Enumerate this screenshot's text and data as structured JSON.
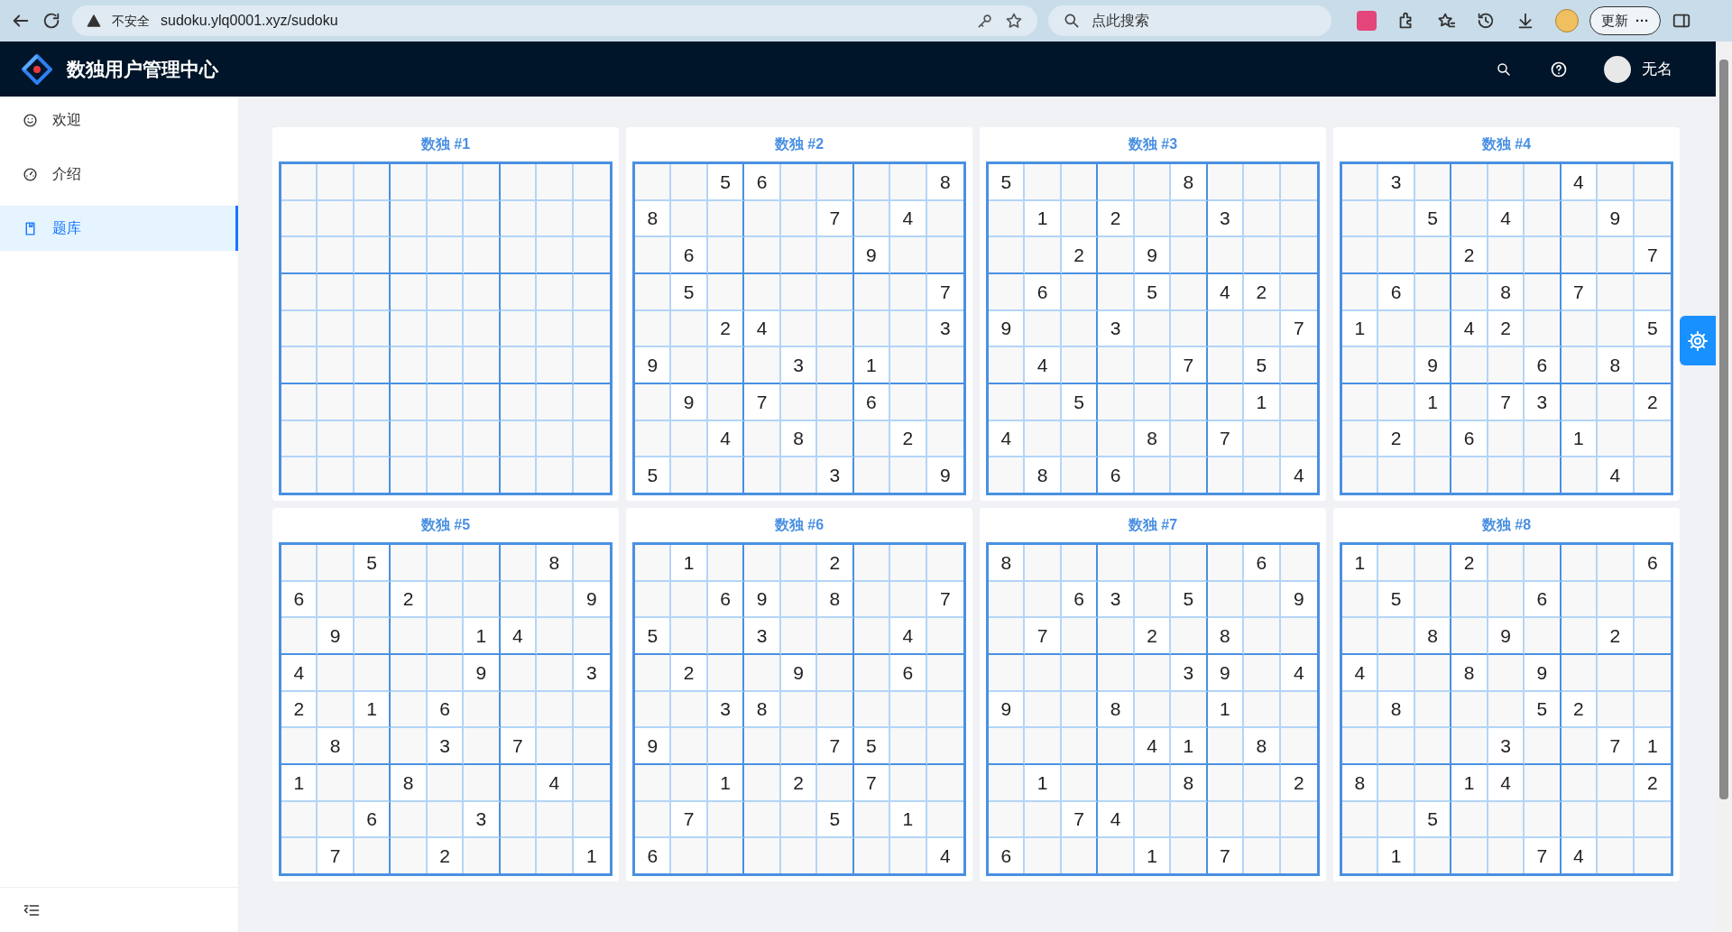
{
  "browser": {
    "security_label": "不安全",
    "url": "sudoku.ylq0001.xyz/sudoku",
    "search_placeholder": "点此搜索",
    "update_button": "更新",
    "more_button": "···"
  },
  "header": {
    "title": "数独用户管理中心",
    "user_name": "无名"
  },
  "sidebar": {
    "items": [
      {
        "label": "欢迎",
        "selected": false
      },
      {
        "label": "介绍",
        "selected": false
      },
      {
        "label": "题库",
        "selected": true
      }
    ]
  },
  "puzzles": [
    {
      "title": "数独 #1",
      "rows": [
        [
          null,
          null,
          null,
          null,
          null,
          null,
          null,
          null,
          null
        ],
        [
          null,
          null,
          null,
          null,
          null,
          null,
          null,
          null,
          null
        ],
        [
          null,
          null,
          null,
          null,
          null,
          null,
          null,
          null,
          null
        ],
        [
          null,
          null,
          null,
          null,
          null,
          null,
          null,
          null,
          null
        ],
        [
          null,
          null,
          null,
          null,
          null,
          null,
          null,
          null,
          null
        ],
        [
          null,
          null,
          null,
          null,
          null,
          null,
          null,
          null,
          null
        ],
        [
          null,
          null,
          null,
          null,
          null,
          null,
          null,
          null,
          null
        ],
        [
          null,
          null,
          null,
          null,
          null,
          null,
          null,
          null,
          null
        ],
        [
          null,
          null,
          null,
          null,
          null,
          null,
          null,
          null,
          null
        ]
      ]
    },
    {
      "title": "数独 #2",
      "rows": [
        [
          null,
          null,
          "5",
          "6",
          null,
          null,
          null,
          null,
          "8"
        ],
        [
          "8",
          null,
          null,
          null,
          null,
          "7",
          null,
          "4",
          null
        ],
        [
          null,
          "6",
          null,
          null,
          null,
          null,
          "9",
          null,
          null
        ],
        [
          null,
          "5",
          null,
          null,
          null,
          null,
          null,
          null,
          "7"
        ],
        [
          null,
          null,
          "2",
          "4",
          null,
          null,
          null,
          null,
          "3"
        ],
        [
          "9",
          null,
          null,
          null,
          "3",
          null,
          "1",
          null,
          null
        ],
        [
          null,
          "9",
          null,
          "7",
          null,
          null,
          "6",
          null,
          null
        ],
        [
          null,
          null,
          "4",
          null,
          "8",
          null,
          null,
          "2",
          null
        ],
        [
          "5",
          null,
          null,
          null,
          null,
          "3",
          null,
          null,
          "9"
        ]
      ]
    },
    {
      "title": "数独 #3",
      "rows": [
        [
          "5",
          null,
          null,
          null,
          null,
          "8",
          null,
          null,
          null
        ],
        [
          null,
          "1",
          null,
          "2",
          null,
          null,
          "3",
          null,
          null
        ],
        [
          null,
          null,
          "2",
          null,
          "9",
          null,
          null,
          null,
          null
        ],
        [
          null,
          "6",
          null,
          null,
          "5",
          null,
          "4",
          "2",
          null
        ],
        [
          "9",
          null,
          null,
          "3",
          null,
          null,
          null,
          null,
          "7"
        ],
        [
          null,
          "4",
          null,
          null,
          null,
          "7",
          null,
          "5",
          null
        ],
        [
          null,
          null,
          "5",
          null,
          null,
          null,
          null,
          "1",
          null
        ],
        [
          "4",
          null,
          null,
          null,
          "8",
          null,
          "7",
          null,
          null
        ],
        [
          null,
          "8",
          null,
          "6",
          null,
          null,
          null,
          null,
          "4"
        ]
      ]
    },
    {
      "title": "数独 #4",
      "rows": [
        [
          null,
          "3",
          null,
          null,
          null,
          null,
          "4",
          null,
          null
        ],
        [
          null,
          null,
          "5",
          null,
          "4",
          null,
          null,
          "9",
          null
        ],
        [
          null,
          null,
          null,
          "2",
          null,
          null,
          null,
          null,
          "7"
        ],
        [
          null,
          "6",
          null,
          null,
          "8",
          null,
          "7",
          null,
          null
        ],
        [
          "1",
          null,
          null,
          "4",
          "2",
          null,
          null,
          null,
          "5"
        ],
        [
          null,
          null,
          "9",
          null,
          null,
          "6",
          null,
          "8",
          null
        ],
        [
          null,
          null,
          "1",
          null,
          "7",
          "3",
          null,
          null,
          "2"
        ],
        [
          null,
          "2",
          null,
          "6",
          null,
          null,
          "1",
          null,
          null
        ],
        [
          null,
          null,
          null,
          null,
          null,
          null,
          null,
          "4",
          null
        ]
      ]
    },
    {
      "title": "数独 #5",
      "rows": [
        [
          null,
          null,
          "5",
          null,
          null,
          null,
          null,
          "8",
          null
        ],
        [
          "6",
          null,
          null,
          "2",
          null,
          null,
          null,
          null,
          "9"
        ],
        [
          null,
          "9",
          null,
          null,
          null,
          "1",
          "4",
          null,
          null
        ],
        [
          "4",
          null,
          null,
          null,
          null,
          "9",
          null,
          null,
          "3"
        ],
        [
          "2",
          null,
          "1",
          null,
          "6",
          null,
          null,
          null,
          null
        ],
        [
          null,
          "8",
          null,
          null,
          "3",
          null,
          "7",
          null,
          null
        ],
        [
          "1",
          null,
          null,
          "8",
          null,
          null,
          null,
          "4",
          null
        ],
        [
          null,
          null,
          "6",
          null,
          null,
          "3",
          null,
          null,
          null
        ],
        [
          null,
          "7",
          null,
          null,
          "2",
          null,
          null,
          null,
          "1"
        ]
      ]
    },
    {
      "title": "数独 #6",
      "rows": [
        [
          null,
          "1",
          null,
          null,
          null,
          "2",
          null,
          null,
          null
        ],
        [
          null,
          null,
          "6",
          "9",
          null,
          "8",
          null,
          null,
          "7"
        ],
        [
          "5",
          null,
          null,
          "3",
          null,
          null,
          null,
          "4",
          null
        ],
        [
          null,
          "2",
          null,
          null,
          "9",
          null,
          null,
          "6",
          null
        ],
        [
          null,
          null,
          "3",
          "8",
          null,
          null,
          null,
          null,
          null
        ],
        [
          "9",
          null,
          null,
          null,
          null,
          "7",
          "5",
          null,
          null
        ],
        [
          null,
          null,
          "1",
          null,
          "2",
          null,
          "7",
          null,
          null
        ],
        [
          null,
          "7",
          null,
          null,
          null,
          "5",
          null,
          "1",
          null
        ],
        [
          "6",
          null,
          null,
          null,
          null,
          null,
          null,
          null,
          "4"
        ]
      ]
    },
    {
      "title": "数独 #7",
      "rows": [
        [
          "8",
          null,
          null,
          null,
          null,
          null,
          null,
          "6",
          null
        ],
        [
          null,
          null,
          "6",
          "3",
          null,
          "5",
          null,
          null,
          "9"
        ],
        [
          null,
          "7",
          null,
          null,
          "2",
          null,
          "8",
          null,
          null
        ],
        [
          null,
          null,
          null,
          null,
          null,
          "3",
          "9",
          null,
          "4"
        ],
        [
          "9",
          null,
          null,
          "8",
          null,
          null,
          "1",
          null,
          null
        ],
        [
          null,
          null,
          null,
          null,
          "4",
          "1",
          null,
          "8",
          null
        ],
        [
          null,
          "1",
          null,
          null,
          null,
          "8",
          null,
          null,
          "2"
        ],
        [
          null,
          null,
          "7",
          "4",
          null,
          null,
          null,
          null,
          null
        ],
        [
          "6",
          null,
          null,
          null,
          "1",
          null,
          "7",
          null,
          null
        ]
      ]
    },
    {
      "title": "数独 #8",
      "rows": [
        [
          "1",
          null,
          null,
          "2",
          null,
          null,
          null,
          null,
          "6"
        ],
        [
          null,
          "5",
          null,
          null,
          null,
          "6",
          null,
          null,
          null
        ],
        [
          null,
          null,
          "8",
          null,
          "9",
          null,
          null,
          "2",
          null
        ],
        [
          "4",
          null,
          null,
          "8",
          null,
          "9",
          null,
          null,
          null
        ],
        [
          null,
          "8",
          null,
          null,
          null,
          "5",
          "2",
          null,
          null
        ],
        [
          null,
          null,
          null,
          null,
          "3",
          null,
          null,
          "7",
          "1"
        ],
        [
          "8",
          null,
          null,
          "1",
          "4",
          null,
          null,
          null,
          "2"
        ],
        [
          null,
          null,
          "5",
          null,
          null,
          null,
          null,
          null,
          null
        ],
        [
          null,
          "1",
          null,
          null,
          null,
          "7",
          "4",
          null,
          null
        ]
      ]
    }
  ]
}
